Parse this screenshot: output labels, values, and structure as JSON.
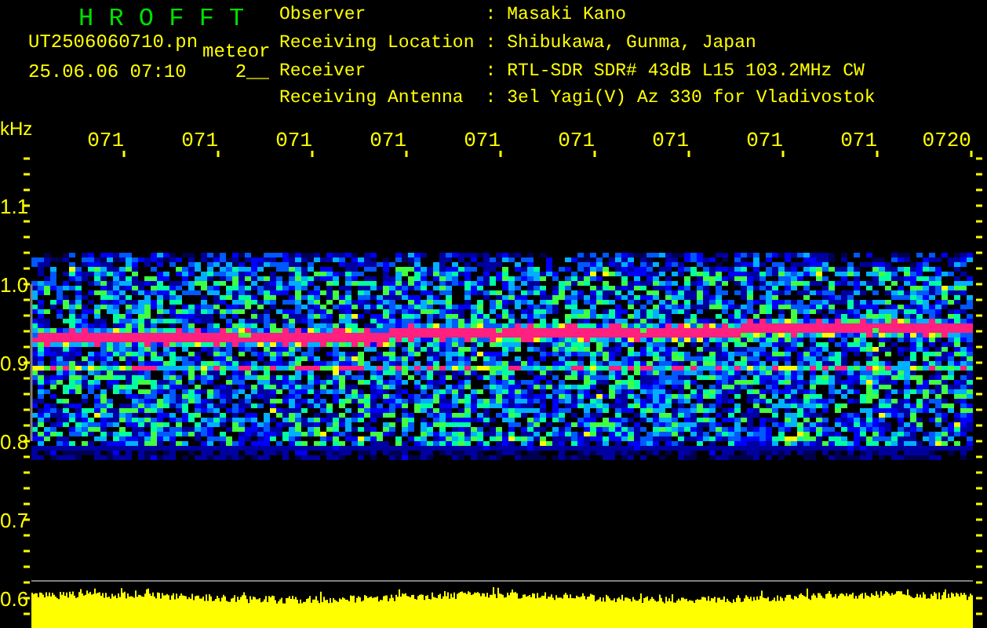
{
  "app_title": "H R O F F T",
  "file_name": "UT2506060710.pn",
  "mode": "meteor",
  "timestamp": "25.06.06 07:10",
  "count": "2__",
  "info": [
    {
      "label": "Observer",
      "separator": ":",
      "value": "Masaki Kano"
    },
    {
      "label": "Receiving Location",
      "separator": ":",
      "value": "Shibukawa, Gunma, Japan"
    },
    {
      "label": "Receiver",
      "separator": ":",
      "value": "RTL-SDR SDR# 43dB L15 103.2MHz CW"
    },
    {
      "label": "Receiving Antenna",
      "separator": ":",
      "value": "3el Yagi(V) Az 330 for Vladivostok"
    }
  ],
  "frequency_unit": "kHz",
  "frequency_labels": [
    "1.1",
    "1.0",
    "0.9",
    "0.8",
    "0.7",
    "0.6"
  ],
  "time_labels": [
    "071",
    "071",
    "071",
    "071",
    "071",
    "071",
    "071",
    "071",
    "071",
    "0720"
  ]
}
